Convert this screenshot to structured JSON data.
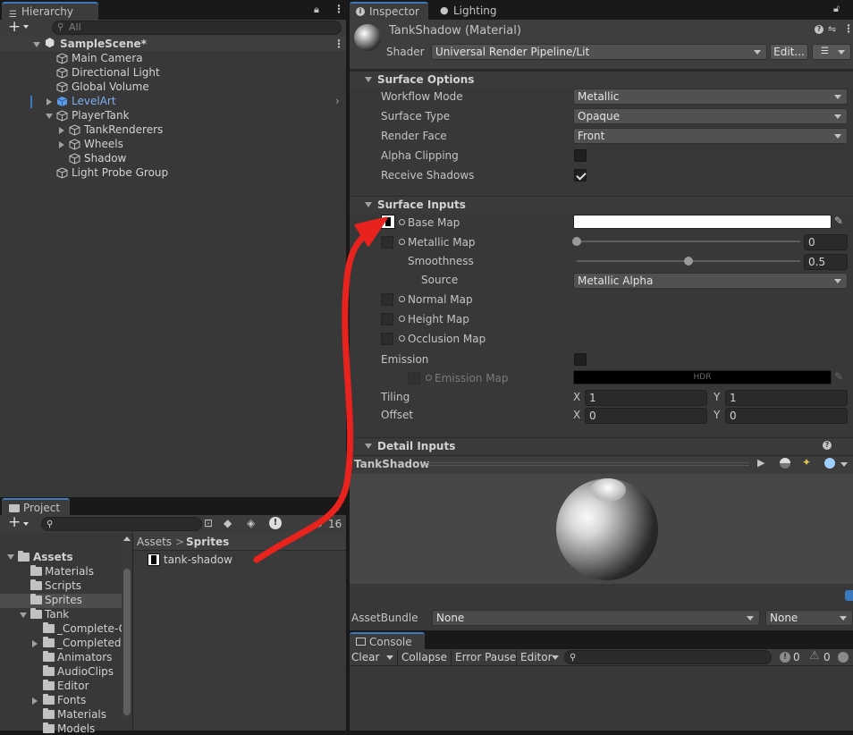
{
  "hierarchy": {
    "tab_label": "Hierarchy",
    "search_placeholder": "All",
    "add_label": "+",
    "scene_name": "SampleScene*",
    "items": [
      "Main Camera",
      "Directional Light",
      "Global Volume",
      "LevelArt",
      "PlayerTank",
      "TankRenderers",
      "Wheels",
      "Shadow",
      "Light Probe Group"
    ]
  },
  "project": {
    "tab_label": "Project",
    "add_label": "+",
    "hidden_count": "16",
    "breadcrumb_root": "Assets",
    "breadcrumb_sep": ">",
    "breadcrumb_current": "Sprites",
    "asset_file": "tank-shadow",
    "tree": [
      "Assets",
      "Materials",
      "Scripts",
      "Sprites",
      "Tank",
      "_Complete-G",
      "_Completed-",
      "Animators",
      "AudioClips",
      "Editor",
      "Fonts",
      "Materials",
      "Models"
    ]
  },
  "inspector": {
    "tab_inspector": "Inspector",
    "tab_lighting": "Lighting",
    "material_name": "TankShadow (Material)",
    "shader_label": "Shader",
    "shader_value": "Universal Render Pipeline/Lit",
    "edit_button": "Edit...",
    "surface_options": {
      "title": "Surface Options",
      "workflow_label": "Workflow Mode",
      "workflow_value": "Metallic",
      "surface_type_label": "Surface Type",
      "surface_type_value": "Opaque",
      "render_face_label": "Render Face",
      "render_face_value": "Front",
      "alpha_label": "Alpha Clipping",
      "receive_label": "Receive Shadows"
    },
    "surface_inputs": {
      "title": "Surface Inputs",
      "base_map": "Base Map",
      "metallic_map": "Metallic Map",
      "metallic_value": "0",
      "metallic_level": 0.0,
      "smoothness": "Smoothness",
      "smoothness_value": "0.5",
      "smoothness_level": 0.5,
      "source_label": "Source",
      "source_value": "Metallic Alpha",
      "normal_map": "Normal Map",
      "height_map": "Height Map",
      "occlusion_map": "Occlusion Map",
      "emission": "Emission",
      "emission_map": "Emission Map",
      "hdr": "HDR",
      "tiling": "Tiling",
      "offset": "Offset",
      "x": "X",
      "y": "Y",
      "tiling_x": "1",
      "tiling_y": "1",
      "offset_x": "0",
      "offset_y": "0"
    },
    "detail_inputs": "Detail Inputs",
    "preview_title": "TankShadow",
    "assetbundle_label": "AssetBundle",
    "assetbundle_value": "None",
    "assetbundle_variant": "None"
  },
  "console": {
    "tab_label": "Console",
    "clear": "Clear",
    "collapse": "Collapse",
    "error_pause": "Error Pause",
    "editor": "Editor",
    "errors": "0",
    "warnings": "0"
  },
  "colors": {
    "accent": "#3a79bb",
    "annotation": "#e8221d",
    "levelart": "#7eaef0"
  }
}
